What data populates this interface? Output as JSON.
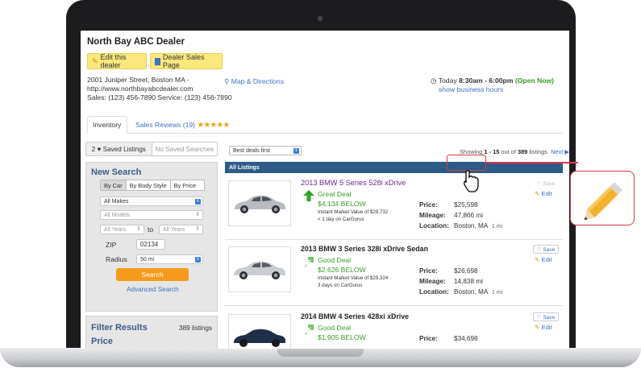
{
  "dealer": {
    "name": "North Bay ABC Dealer",
    "edit_btn": "Edit this dealer",
    "sales_btn": "Dealer Sales Page",
    "address": "2001 Juniper Street, Boston MA -",
    "website": "http://www.northbayabcdealer.com",
    "phones": "Sales: (123) 456-7890   Service: (123) 456-7890",
    "map_link": "Map & Directions",
    "hours_prefix": "Today",
    "hours": "8:30am - 6:00pm",
    "open_status": "(Open Now)",
    "show_hours": "show business hours"
  },
  "tabs": {
    "inventory": "Inventory",
    "reviews": "Sales Reviews (19)",
    "stars": "★★★★★"
  },
  "saved": {
    "listings": "2 ♥ Saved Listings",
    "searches": "No Saved Searches"
  },
  "search": {
    "title": "New Search",
    "by_car": "By Car",
    "by_body": "By Body Style",
    "by_price": "By Price",
    "makes": "All Makes",
    "models": "All Models",
    "year_from": "All Years",
    "to": "to",
    "year_to": "All Years",
    "zip_label": "ZIP",
    "zip_value": "02134",
    "radius_label": "Radius",
    "radius_value": "50 mi",
    "search_btn": "Search",
    "advanced": "Advanced Search"
  },
  "filter": {
    "title": "Filter Results",
    "count": "389 listings",
    "price": "Price"
  },
  "results": {
    "sort": "Best deals first",
    "showing_prefix": "Showing",
    "range": "1 - 15",
    "out_of": "out of",
    "total": "389",
    "listings_word": "listings",
    "next": "Next ▶",
    "all_listings": "All Listings"
  },
  "listings": [
    {
      "title": "2013 BMW 5 Series 528i xDrive",
      "deal": "Great Deal",
      "below": "$4,134 BELOW",
      "imv": "Instant Market Value of $29,732",
      "days": "< 1 day on CarGurus",
      "price_label": "Price:",
      "price": "$25,598",
      "mileage_label": "Mileage:",
      "mileage": "47,866 mi",
      "location_label": "Location:",
      "location": "Boston, MA",
      "distance": "1 mi",
      "save": "♡ Save",
      "edit": "Edit"
    },
    {
      "title": "2013 BMW 3 Series 328i xDrive Sedan",
      "deal": "Good Deal",
      "below": "$2,626 BELOW",
      "imv": "Instant Market Value of $29,324",
      "days": "3 days on CarGurus",
      "price_label": "Price:",
      "price": "$26,698",
      "mileage_label": "Mileage:",
      "mileage": "14,838 mi",
      "location_label": "Location:",
      "location": "Boston, MA",
      "distance": "1 mi",
      "save": "♡ Save",
      "edit": "Edit"
    },
    {
      "title": "2014 BMW 4 Series 428xi xDrive",
      "deal": "Good Deal",
      "below": "$1,905 BELOW",
      "price_label": "Price:",
      "price": "$34,698",
      "save": "♡ Save",
      "edit": "Edit"
    }
  ],
  "colors": {
    "accent_blue": "#3a73c1",
    "deal_green": "#3c9b2a",
    "header_bar": "#2d5a86",
    "search_orange": "#f59a1b",
    "callout_red": "#d9394a"
  }
}
